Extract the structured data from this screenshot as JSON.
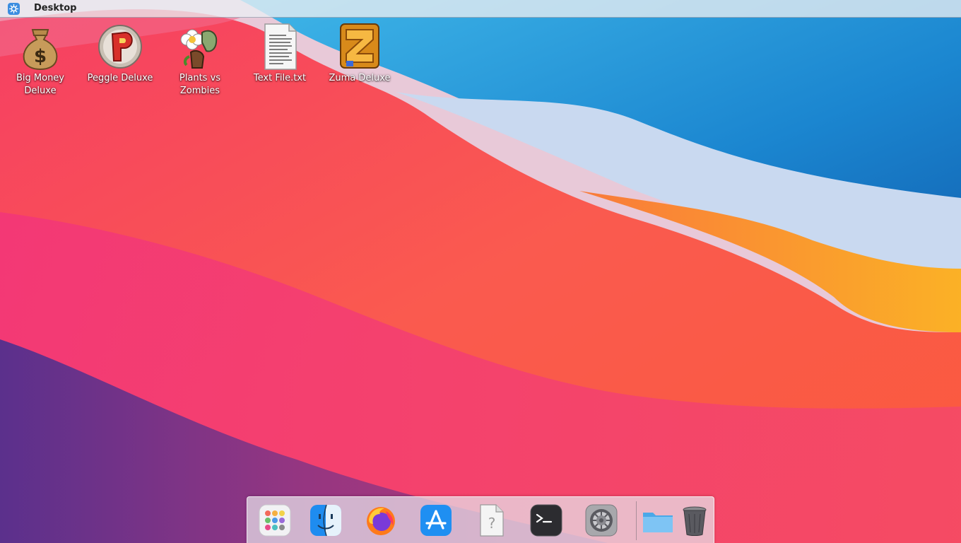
{
  "menubar": {
    "title": "Desktop",
    "logo_icon": "kde-logo-icon"
  },
  "desktop_icons": [
    {
      "label": "Big Money\nDeluxe",
      "icon": "money-bag-icon"
    },
    {
      "label": "Peggle Deluxe",
      "icon": "peggle-icon"
    },
    {
      "label": "Plants vs\nZombies",
      "icon": "plants-vs-zombies-icon"
    },
    {
      "label": "Text File.txt",
      "icon": "text-file-icon"
    },
    {
      "label": "Zuma Deluxe",
      "icon": "zuma-icon"
    }
  ],
  "dock": {
    "items": [
      {
        "icon": "launchpad-icon"
      },
      {
        "icon": "finder-icon"
      },
      {
        "icon": "firefox-icon"
      },
      {
        "icon": "app-store-icon"
      },
      {
        "icon": "unknown-file-icon"
      },
      {
        "icon": "terminal-icon"
      },
      {
        "icon": "system-preferences-icon"
      },
      {
        "icon": "folder-icon"
      },
      {
        "icon": "trash-icon"
      }
    ]
  },
  "colors": {
    "wallpaper_red": "#f23a62",
    "wallpaper_blue": "#1a8ad4",
    "wallpaper_orange": "#f8a428",
    "wallpaper_purple": "#4a2f8a"
  }
}
